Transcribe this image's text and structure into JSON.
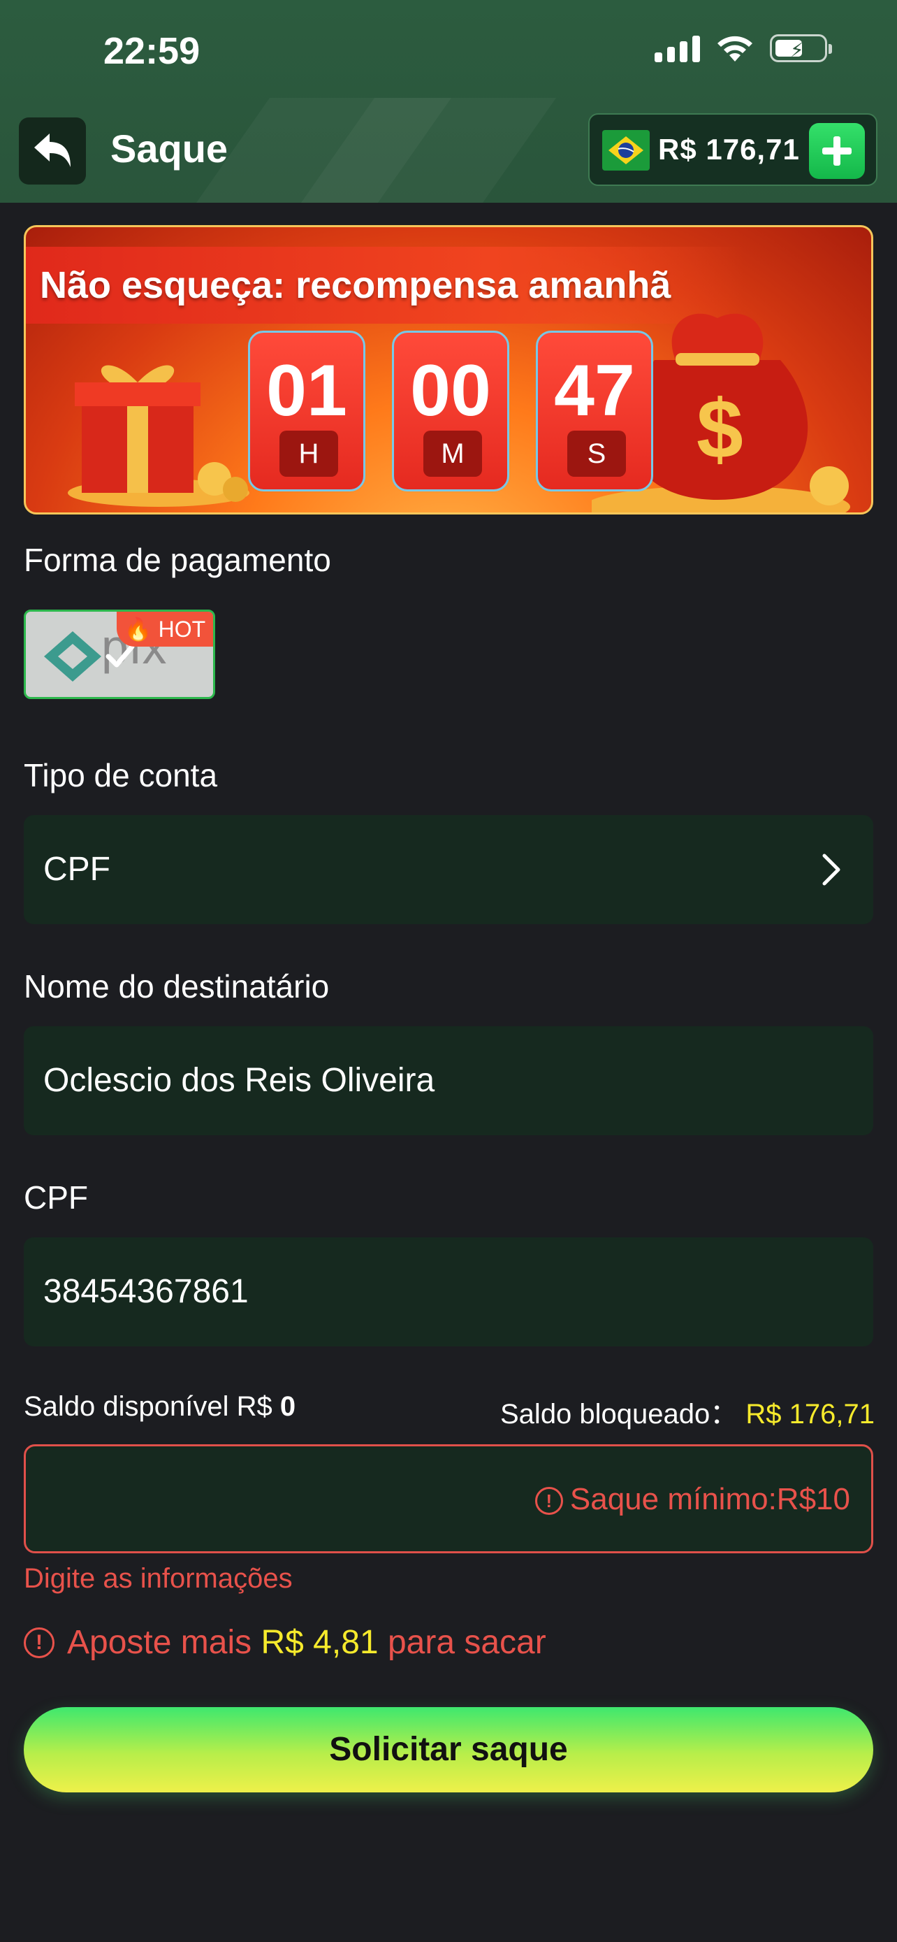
{
  "status_bar": {
    "time": "22:59"
  },
  "header": {
    "title": "Saque",
    "balance": "R$ 176,71"
  },
  "banner": {
    "title": "Não esqueça: recompensa amanhã",
    "timer": [
      {
        "value": "01",
        "unit": "H"
      },
      {
        "value": "00",
        "unit": "M"
      },
      {
        "value": "47",
        "unit": "S"
      }
    ]
  },
  "payment": {
    "label": "Forma de pagamento",
    "method": "pix",
    "badge": "HOT"
  },
  "account_type": {
    "label": "Tipo de conta",
    "value": "CPF"
  },
  "recipient": {
    "label": "Nome do destinatário",
    "value": "Oclescio dos Reis Oliveira"
  },
  "cpf": {
    "label": "CPF",
    "value": "38454367861"
  },
  "saldo": {
    "available_label": "Saldo disponível R$",
    "available_value": "0",
    "blocked_label": "Saldo bloqueado：",
    "blocked_value": "R$ 176,71"
  },
  "amount": {
    "placeholder": "Saque mínimo:R$10"
  },
  "errors": {
    "fill_info": "Digite as informações",
    "bet_prefix": "Aposte mais",
    "bet_amount": "R$ 4,81",
    "bet_suffix": "para sacar"
  },
  "submit_label": "Solicitar saque",
  "colors": {
    "accent_green": "#3ee86e",
    "error": "#e8524b",
    "highlight": "#f6ea2c",
    "field_bg": "#16291f"
  }
}
